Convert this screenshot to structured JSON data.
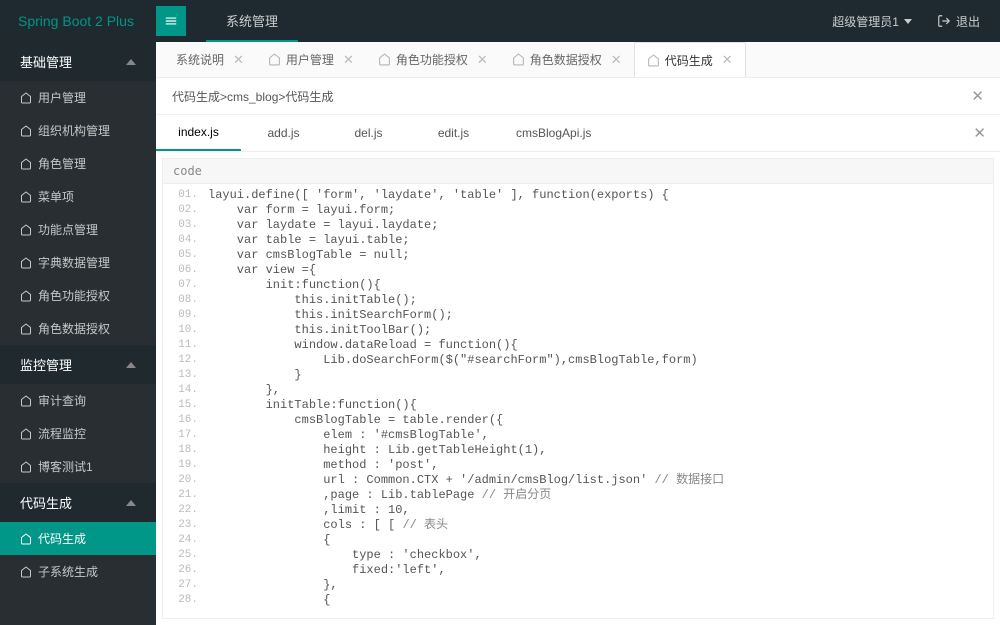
{
  "header": {
    "brand": "Spring Boot 2 Plus",
    "top_tab": "系统管理",
    "user": "超级管理员1",
    "logout": "退出"
  },
  "sidebar": {
    "g1": {
      "title": "基础管理"
    },
    "g1_items": [
      "用户管理",
      "组织机构管理",
      "角色管理",
      "菜单项",
      "功能点管理",
      "字典数据管理",
      "角色功能授权",
      "角色数据授权"
    ],
    "g2": {
      "title": "监控管理"
    },
    "g2_items": [
      "审计查询",
      "流程监控",
      "博客测试1"
    ],
    "g3": {
      "title": "代码生成"
    },
    "g3_items": [
      "代码生成",
      "子系统生成"
    ]
  },
  "tabs": [
    {
      "label": "系统说明",
      "closable": true,
      "icon": false
    },
    {
      "label": "用户管理",
      "closable": true,
      "icon": true
    },
    {
      "label": "角色功能授权",
      "closable": true,
      "icon": true
    },
    {
      "label": "角色数据授权",
      "closable": true,
      "icon": true
    },
    {
      "label": "代码生成",
      "closable": true,
      "icon": true,
      "active": true
    }
  ],
  "breadcrumb": "代码生成>cms_blog>代码生成",
  "filetabs": [
    "index.js",
    "add.js",
    "del.js",
    "edit.js",
    "cmsBlogApi.js"
  ],
  "filetab_active": 0,
  "code_title": "code",
  "code_lines": [
    "layui.define([ 'form', 'laydate', 'table' ], function(exports) {",
    "    var form = layui.form;",
    "    var laydate = layui.laydate;",
    "    var table = layui.table;",
    "    var cmsBlogTable = null;",
    "    var view ={",
    "        init:function(){",
    "            this.initTable();",
    "            this.initSearchForm();",
    "            this.initToolBar();",
    "            window.dataReload = function(){",
    "                Lib.doSearchForm($(\"#searchForm\"),cmsBlogTable,form)",
    "            }",
    "        },",
    "        initTable:function(){",
    "            cmsBlogTable = table.render({",
    "                elem : '#cmsBlogTable',",
    "                height : Lib.getTableHeight(1),",
    "                method : 'post',",
    "                url : Common.CTX + '/admin/cmsBlog/list.json' // 数据接口",
    "                ,page : Lib.tablePage // 开启分页",
    "                ,limit : 10,",
    "                cols : [ [ // 表头",
    "                {",
    "                    type : 'checkbox',",
    "                    fixed:'left',",
    "                },",
    "                {"
  ]
}
